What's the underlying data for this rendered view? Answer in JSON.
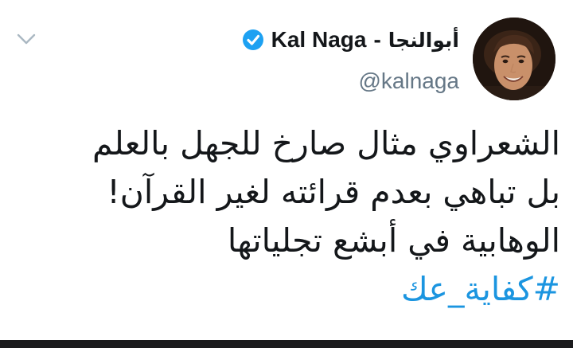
{
  "tweet": {
    "display_name": "Kal Naga",
    "name_separator": "-",
    "display_name_arabic": "أبوالنجا",
    "handle": "@kalnaga",
    "verified": true,
    "menu_icon": "chevron-down-icon",
    "text_lines": [
      "الشعراوي مثال صارخ للجهل بالعلم",
      "بل تباهي بعدم قرائته لغير القرآن!",
      "الوهابية في أبشع تجلياتها"
    ],
    "hashtag": "#كفاية_عك"
  },
  "colors": {
    "text": "#14171a",
    "handle": "#657786",
    "link": "#1b95e0",
    "verified_badge": "#1da1f2",
    "chevron": "#aab8c2"
  }
}
